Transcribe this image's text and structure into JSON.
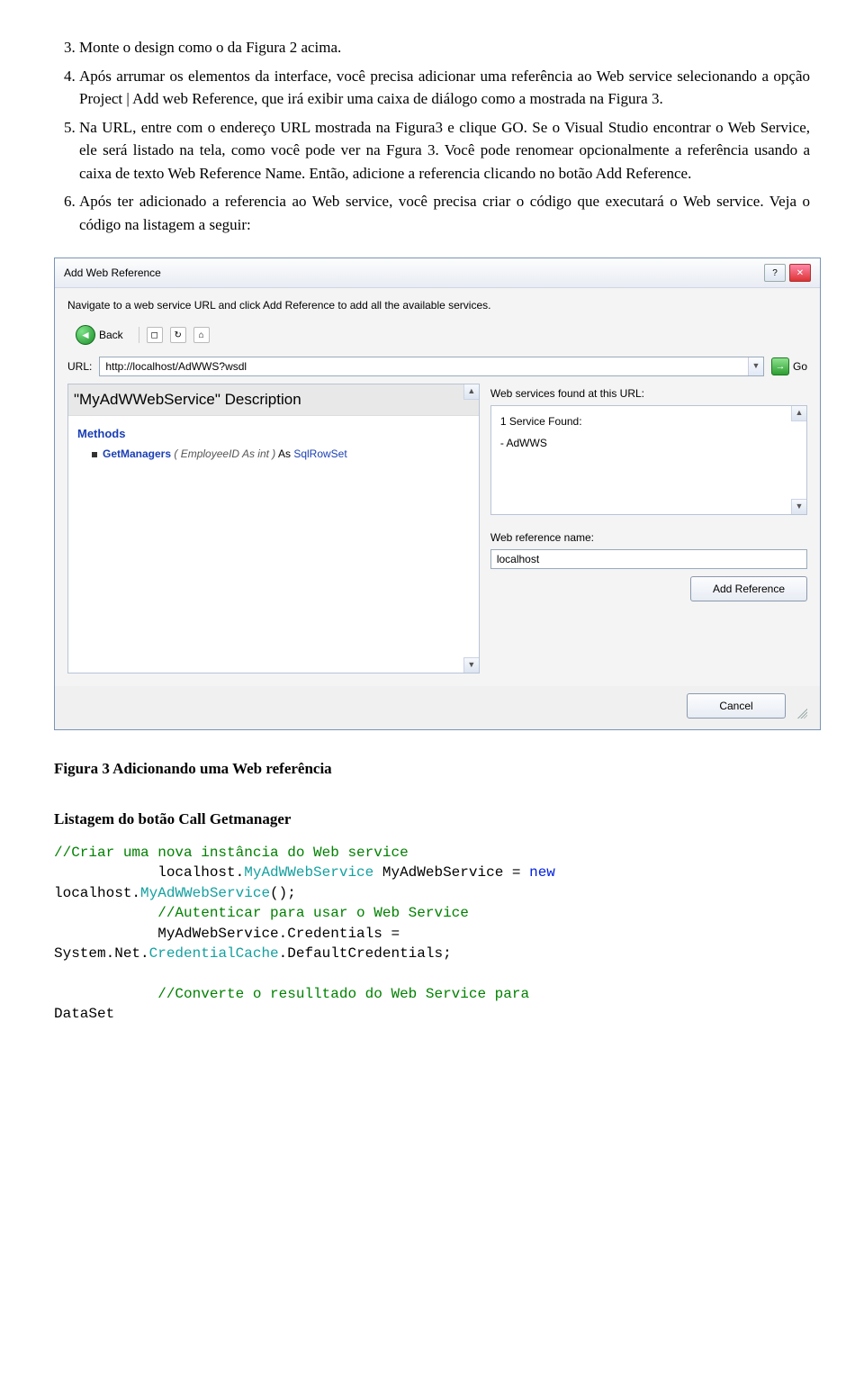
{
  "list": {
    "start": 3,
    "items": [
      "Monte o design como o da Figura 2 acima.",
      "Após arrumar os elementos da interface, você precisa adicionar uma referência ao Web service selecionando a opção Project | Add web Reference, que irá exibir uma caixa de diálogo como a mostrada na Figura 3.",
      "Na URL, entre com o endereço URL mostrada na Figura3 e clique GO. Se o Visual Studio encontrar o Web Service, ele será listado na tela, como você pode ver na Fgura 3. Você pode renomear opcionalmente a referência usando a caixa de texto Web Reference Name. Então, adicione a referencia clicando no botão Add Reference.",
      "Após ter adicionado a referencia ao Web service, você precisa criar o código que executará o Web service. Veja o código na listagem a seguir:"
    ]
  },
  "dialog": {
    "title": "Add Web Reference",
    "desc": "Navigate to a web service URL and click Add Reference to add all the available services.",
    "back": "Back",
    "urlLabel": "URL:",
    "urlValue": "http://localhost/AdWWS?wsdl",
    "go": "Go",
    "svcTitle": "\"MyAdWWebService\" Description",
    "methodsHeader": "Methods",
    "method": {
      "name": "GetManagers",
      "params": "( EmployeeID As int )",
      "asWord": "As",
      "ret": "SqlRowSet"
    },
    "foundLabel": "Web services found at this URL:",
    "foundLine1": "1 Service Found:",
    "foundLine2": "- AdWWS",
    "refNameLabel": "Web reference name:",
    "refNameValue": "localhost",
    "addRef": "Add Reference",
    "cancel": "Cancel"
  },
  "figCaption": {
    "b": "Figura 3",
    "rest": " Adicionando uma Web referência"
  },
  "listingHeader": "Listagem do botão Call Getmanager",
  "code": {
    "l1": "//Criar uma nova instância do Web service",
    "l2a": "            localhost.",
    "l2b": "MyAdWWebService",
    "l2c": " MyAdWebService = ",
    "l2d": "new",
    "l3a": "localhost.",
    "l3b": "MyAdWWebService",
    "l3c": "();",
    "l4": "            //Autenticar para usar o Web Service",
    "l5": "            MyAdWebService.Credentials =",
    "l6a": "System.Net.",
    "l6b": "CredentialCache",
    "l6c": ".DefaultCredentials;",
    "l7": "            //Converte o resulltado do Web Service para",
    "l8": "DataSet"
  }
}
